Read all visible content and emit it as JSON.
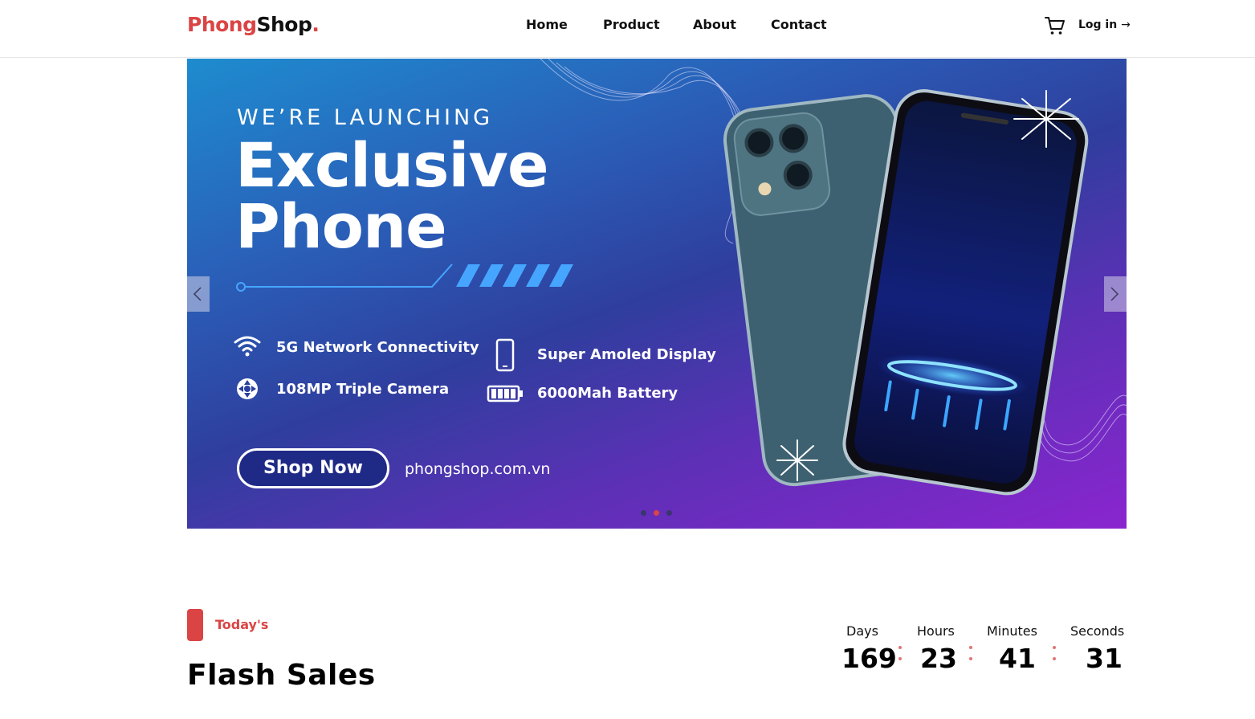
{
  "brand": {
    "part1": "Phong",
    "part2": "Shop",
    "part3": "."
  },
  "nav": {
    "items": [
      "Home",
      "Product",
      "About",
      "Contact"
    ]
  },
  "header": {
    "login_label": "Log in",
    "login_arrow": "→"
  },
  "hero": {
    "kicker": "WE’RE LAUNCHING",
    "title_line1": "Exclusive",
    "title_line2": "Phone",
    "features": [
      "5G Network Connectivity",
      "108MP Triple Camera",
      "Super Amoled Display",
      "6000Mah Battery"
    ],
    "cta_label": "Shop Now",
    "website": "phongshop.com.vn",
    "slides_total": 3,
    "slide_active": 2
  },
  "flash": {
    "tag": "Today's",
    "title": "Flash Sales",
    "countdown": [
      {
        "label": "Days",
        "value": "169"
      },
      {
        "label": "Hours",
        "value": "23"
      },
      {
        "label": "Minutes",
        "value": "41"
      },
      {
        "label": "Seconds",
        "value": "31"
      }
    ]
  },
  "colors": {
    "accent": "#db4444",
    "banner_start": "#1e8ccf",
    "banner_end": "#8a25cf",
    "button_fill": "#1f2a86"
  },
  "icons": [
    "cart-icon",
    "arrow-right-icon",
    "chevron-left-icon",
    "chevron-right-icon",
    "wifi-icon",
    "camera-aperture-icon",
    "smartphone-icon",
    "battery-icon"
  ]
}
